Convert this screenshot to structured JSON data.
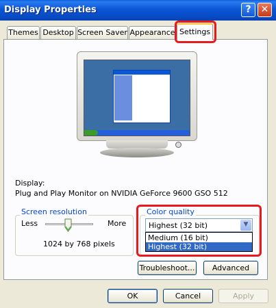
{
  "window": {
    "title": "Display Properties",
    "help_glyph": "?",
    "close_glyph": "✕"
  },
  "tabs": [
    {
      "label": "Themes",
      "active": false
    },
    {
      "label": "Desktop",
      "active": false
    },
    {
      "label": "Screen Saver",
      "active": false
    },
    {
      "label": "Appearance",
      "active": false
    },
    {
      "label": "Settings",
      "active": true
    }
  ],
  "display": {
    "label": "Display:",
    "device": "Plug and Play Monitor on NVIDIA GeForce 9600 GSO 512"
  },
  "screen_resolution": {
    "legend": "Screen resolution",
    "less_label": "Less",
    "more_label": "More",
    "value_text": "1024 by 768 pixels"
  },
  "color_quality": {
    "legend": "Color quality",
    "selected": "Highest (32 bit)",
    "options": [
      "Medium (16 bit)",
      "Highest (32 bit)"
    ],
    "selected_index": 1
  },
  "buttons": {
    "troubleshoot": "Troubleshoot...",
    "advanced": "Advanced",
    "ok": "OK",
    "cancel": "Cancel",
    "apply": "Apply"
  },
  "colors": {
    "highlight_red": "#e8181c",
    "selection_blue": "#316ac5",
    "legend_blue": "#0046d5"
  }
}
